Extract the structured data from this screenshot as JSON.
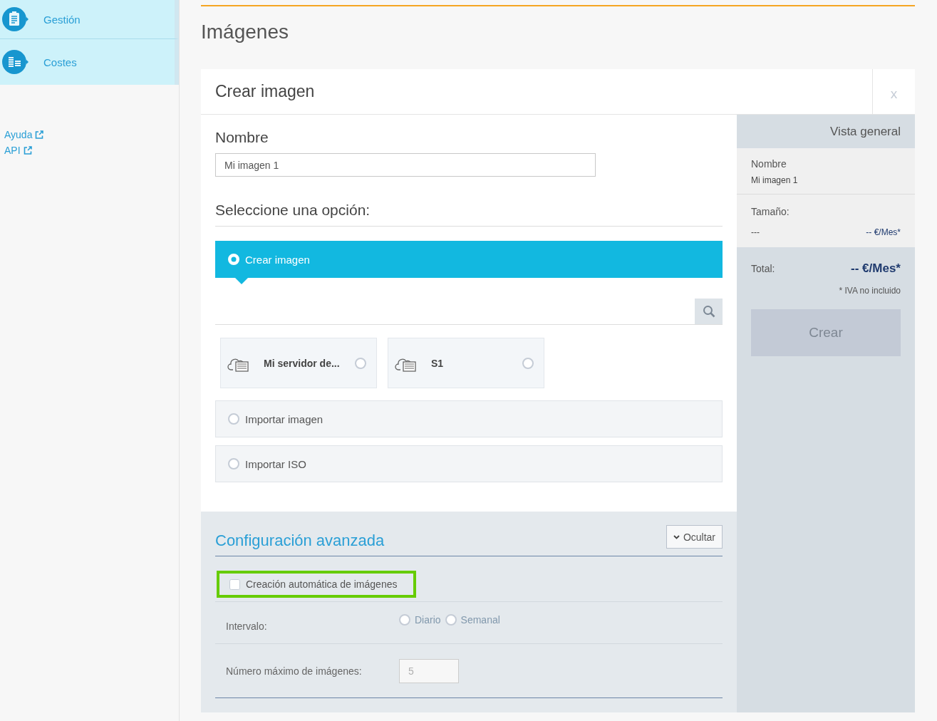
{
  "sidebar": {
    "items": [
      {
        "label": "Gestión",
        "kind": "clipboard"
      },
      {
        "label": "Costes",
        "kind": "coins"
      }
    ],
    "links": [
      "Ayuda",
      "API"
    ]
  },
  "page_title": "Imágenes",
  "dialog": {
    "title": "Crear imagen",
    "close": "x",
    "name_field": {
      "label": "Nombre",
      "value": "Mi imagen 1"
    },
    "options_heading": "Seleccione una opción:",
    "options": [
      {
        "label": "Crear imagen",
        "selected": true,
        "servers": [
          {
            "name": "Mi servidor de...",
            "selected": false
          },
          {
            "name": "S1",
            "selected": false
          }
        ]
      },
      {
        "label": "Importar imagen",
        "selected": false
      },
      {
        "label": "Importar ISO",
        "selected": false
      }
    ],
    "advanced": {
      "title": "Configuración avanzada",
      "toggle": "Ocultar",
      "auto": {
        "label": "Creación automática de imágenes",
        "checked": false,
        "highlighted": true
      },
      "interval": {
        "label": "Intervalo:",
        "disabled": true,
        "options": [
          {
            "label": "Diario",
            "selected": false
          },
          {
            "label": "Semanal",
            "selected": false
          }
        ]
      },
      "max_images": {
        "label": "Número máximo de imágenes:",
        "value": "5",
        "disabled": true
      }
    }
  },
  "overview": {
    "title": "Vista general",
    "name_label": "Nombre",
    "name_value": "Mi imagen 1",
    "size_label": "Tamaño:",
    "size_value": "---",
    "size_price": "-- €/Mes*",
    "total_label": "Total:",
    "total_price": "-- €/Mes*",
    "note": "* IVA no incluido",
    "submit": {
      "label": "Crear",
      "disabled": true
    }
  }
}
